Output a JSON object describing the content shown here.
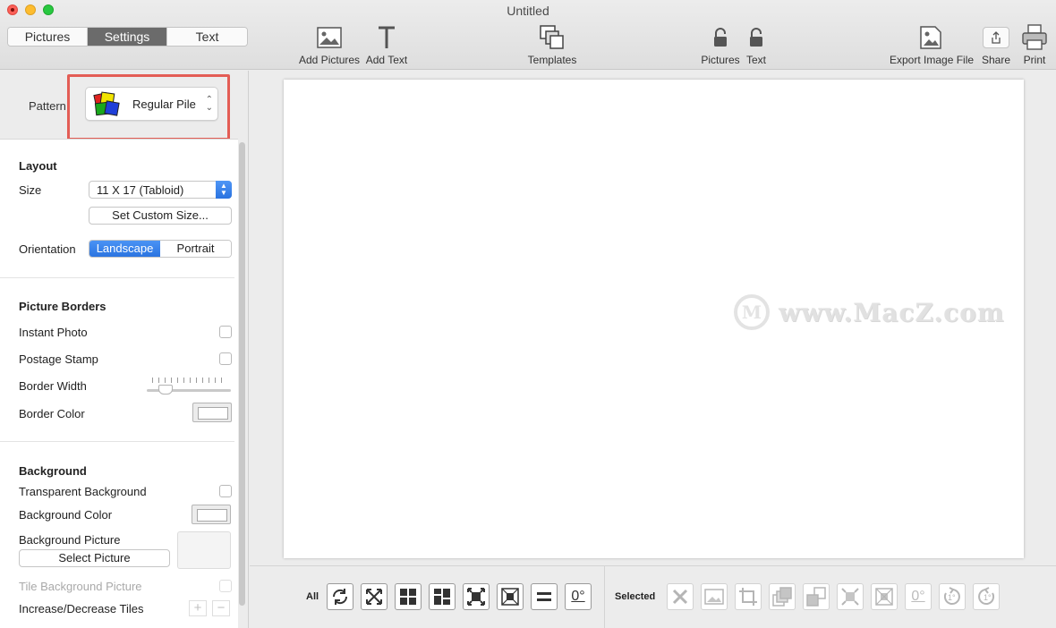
{
  "window": {
    "title": "Untitled"
  },
  "toolbar": {
    "segments": [
      "Pictures",
      "Settings",
      "Text"
    ],
    "active_segment": "Settings",
    "add_pictures": "Add Pictures",
    "add_text": "Add Text",
    "templates": "Templates",
    "lock_pictures": "Pictures",
    "lock_text": "Text",
    "export": "Export Image File",
    "share": "Share",
    "print": "Print"
  },
  "pattern": {
    "label": "Pattern",
    "value": "Regular Pile"
  },
  "layout": {
    "title": "Layout",
    "size_label": "Size",
    "size_value": "11 X 17 (Tabloid)",
    "custom_size_button": "Set Custom Size...",
    "orientation_label": "Orientation",
    "orientation_options": [
      "Landscape",
      "Portrait"
    ],
    "orientation_selected": "Landscape"
  },
  "borders": {
    "title": "Picture Borders",
    "instant_photo": "Instant Photo",
    "postage_stamp": "Postage Stamp",
    "border_width": "Border Width",
    "border_color": "Border Color"
  },
  "background": {
    "title": "Background",
    "transparent": "Transparent Background",
    "color": "Background Color",
    "picture": "Background Picture",
    "select_picture": "Select Picture",
    "tile": "Tile Background Picture",
    "increase_decrease": "Increase/Decrease Tiles"
  },
  "watermark": {
    "text": "www.MacZ.com",
    "logo_letter": "M"
  },
  "bottom": {
    "all_label": "All",
    "selected_label": "Selected",
    "rotation_text": "0°",
    "rotate_left": "1°",
    "rotate_right": "1°"
  },
  "colors": {
    "accent": "#2b74e0",
    "highlight_box": "#e35d55"
  }
}
